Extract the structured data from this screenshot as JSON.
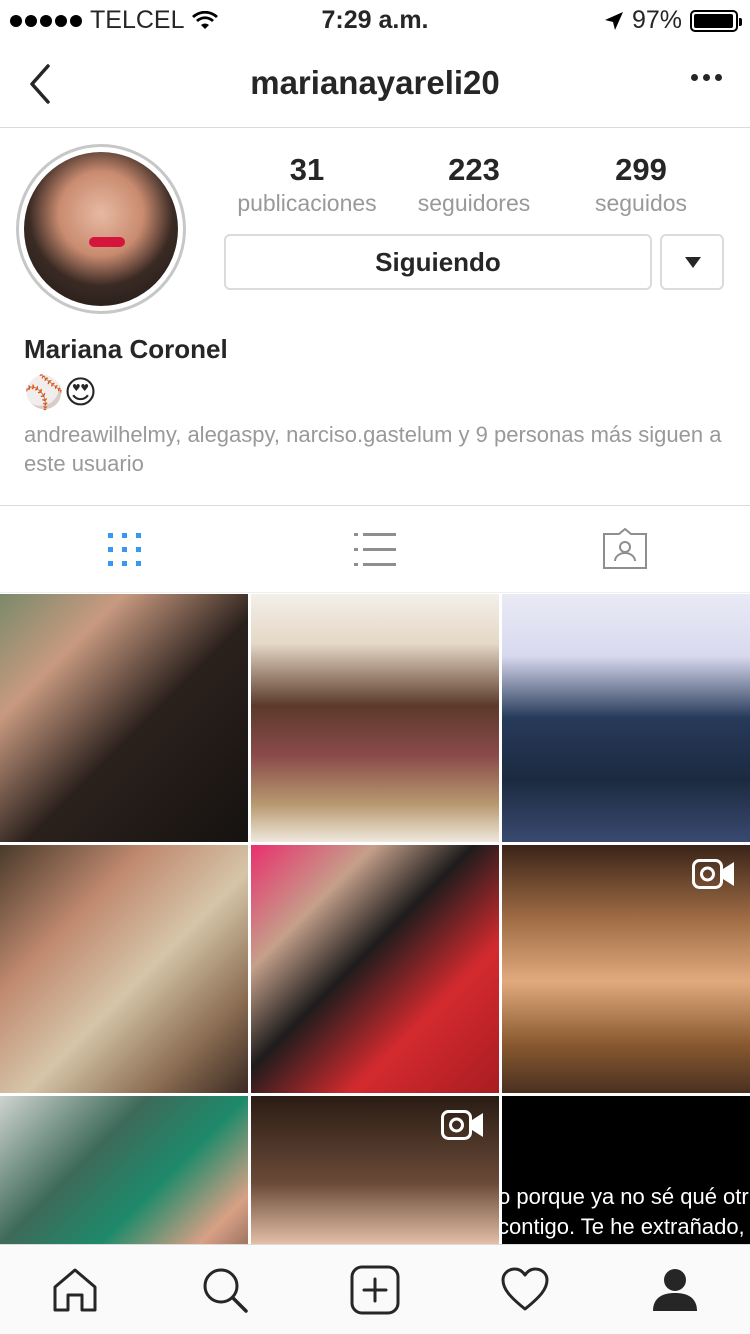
{
  "status_bar": {
    "carrier": "TELCEL",
    "time": "7:29 a.m.",
    "battery_text": "97%",
    "battery_level": 0.97,
    "signal_bars": 5
  },
  "nav": {
    "title": "marianayareli20",
    "back_icon": "chevron-left-icon",
    "more_icon": "more-horizontal-icon"
  },
  "profile": {
    "stats": [
      {
        "value": "31",
        "label": "publicaciones"
      },
      {
        "value": "223",
        "label": "seguidores"
      },
      {
        "value": "299",
        "label": "seguidos"
      }
    ],
    "follow_button_label": "Siguiendo",
    "full_name": "Mariana Coronel",
    "bio": "⚾😍",
    "followed_by": "andreawilhelmy, alegaspy, narciso.gastelum y 9 personas más siguen a este usuario"
  },
  "tabs": [
    {
      "icon": "grid-icon",
      "active": true
    },
    {
      "icon": "list-icon",
      "active": false
    },
    {
      "icon": "tagged-photos-icon",
      "active": false
    }
  ],
  "grid": {
    "posts": [
      {
        "type": "photo"
      },
      {
        "type": "photo"
      },
      {
        "type": "photo"
      },
      {
        "type": "photo"
      },
      {
        "type": "photo"
      },
      {
        "type": "video"
      },
      {
        "type": "photo"
      },
      {
        "type": "video"
      },
      {
        "type": "photo",
        "text_lines": [
          "o porque ya no sé qué otr",
          "contigo. Te he extrañado,"
        ]
      }
    ]
  },
  "bottom_bar": [
    {
      "icon": "home-icon"
    },
    {
      "icon": "search-icon"
    },
    {
      "icon": "add-post-icon"
    },
    {
      "icon": "heart-icon"
    },
    {
      "icon": "profile-icon",
      "active": true
    }
  ],
  "colors": {
    "accent": "#3897f0",
    "text": "#262626",
    "muted": "#999999",
    "border": "#dbdbdb"
  }
}
